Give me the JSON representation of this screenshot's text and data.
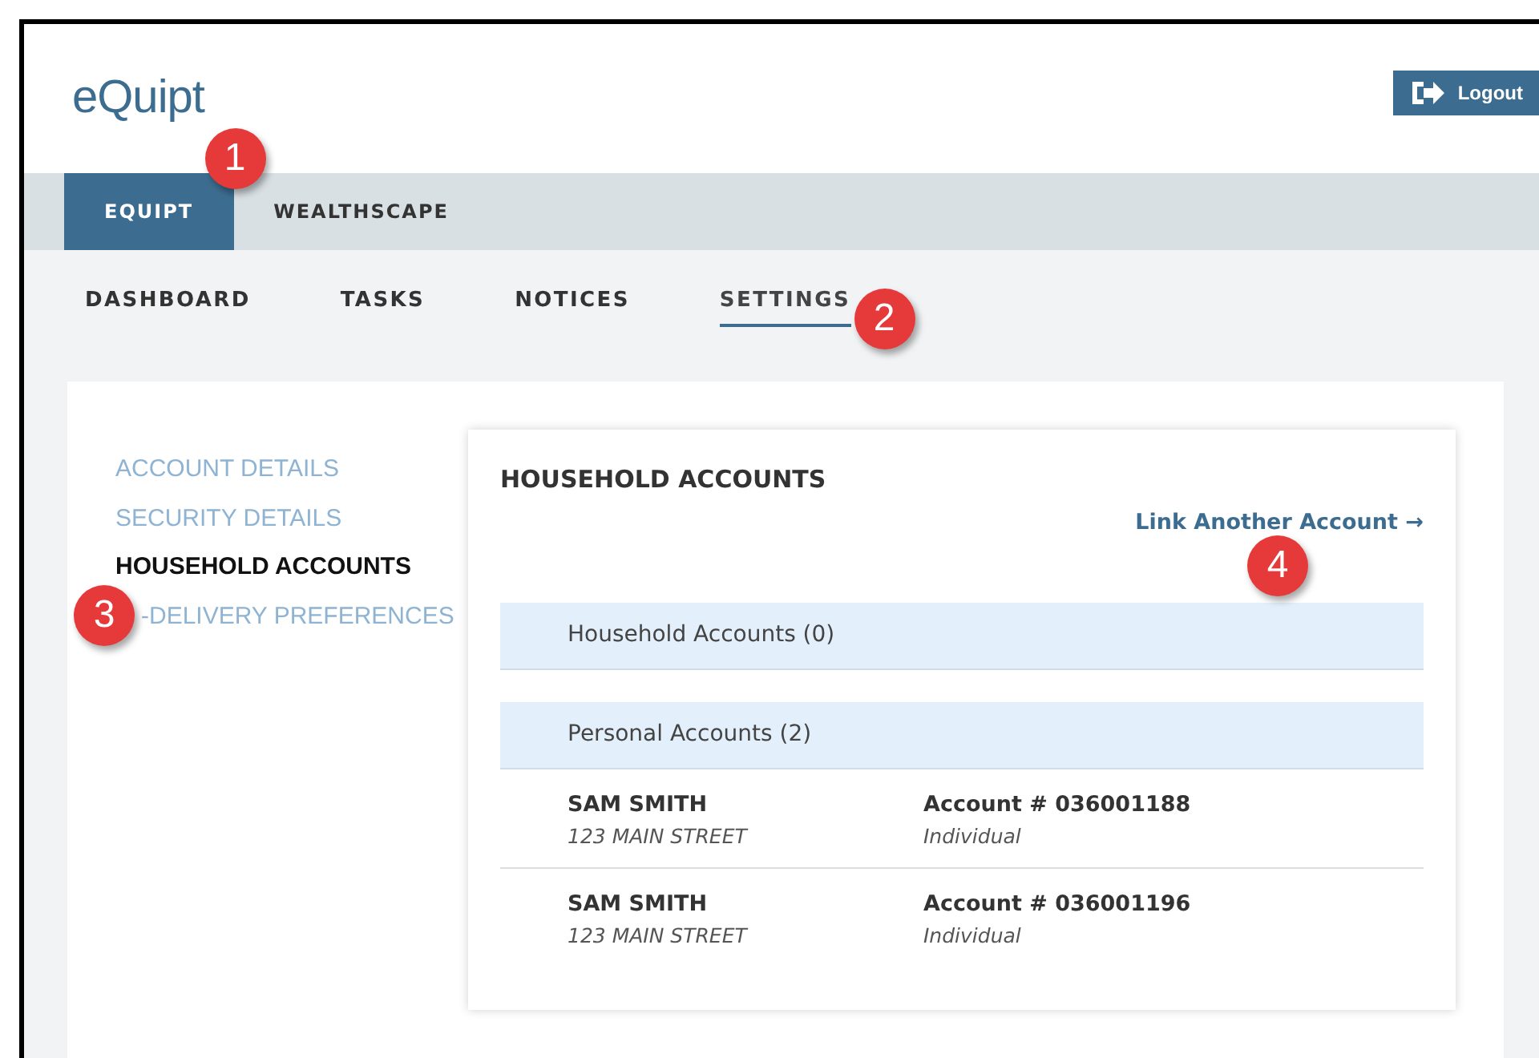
{
  "logo": "eQuipt",
  "logout": {
    "label": "Logout"
  },
  "top_tabs": [
    {
      "label": "EQUIPT",
      "selected": true,
      "callout": "1"
    },
    {
      "label": "WEALTHSCAPE",
      "selected": false
    }
  ],
  "sub_nav": [
    {
      "label": "DASHBOARD",
      "selected": false
    },
    {
      "label": "TASKS",
      "selected": false
    },
    {
      "label": "NOTICES",
      "selected": false
    },
    {
      "label": "SETTINGS",
      "selected": true,
      "callout": "2"
    }
  ],
  "sidebar": {
    "items": [
      {
        "label": "ACCOUNT DETAILS",
        "selected": false
      },
      {
        "label": "SECURITY DETAILS",
        "selected": false
      },
      {
        "label": "HOUSEHOLD ACCOUNTS",
        "selected": true
      },
      {
        "label": "-DELIVERY PREFERENCES",
        "selected": false,
        "callout": "3"
      }
    ]
  },
  "panel": {
    "title": "HOUSEHOLD ACCOUNTS",
    "link": {
      "label": "Link Another Account →",
      "callout": "4"
    },
    "groups": [
      {
        "label": "Household Accounts (0)"
      },
      {
        "label": "Personal Accounts (2)",
        "accounts": [
          {
            "name": "SAM SMITH",
            "address": "123 MAIN STREET",
            "account": "Account # 036001188",
            "type": "Individual"
          },
          {
            "name": "SAM SMITH",
            "address": "123 MAIN STREET",
            "account": "Account # 036001196",
            "type": "Individual"
          }
        ]
      }
    ]
  }
}
